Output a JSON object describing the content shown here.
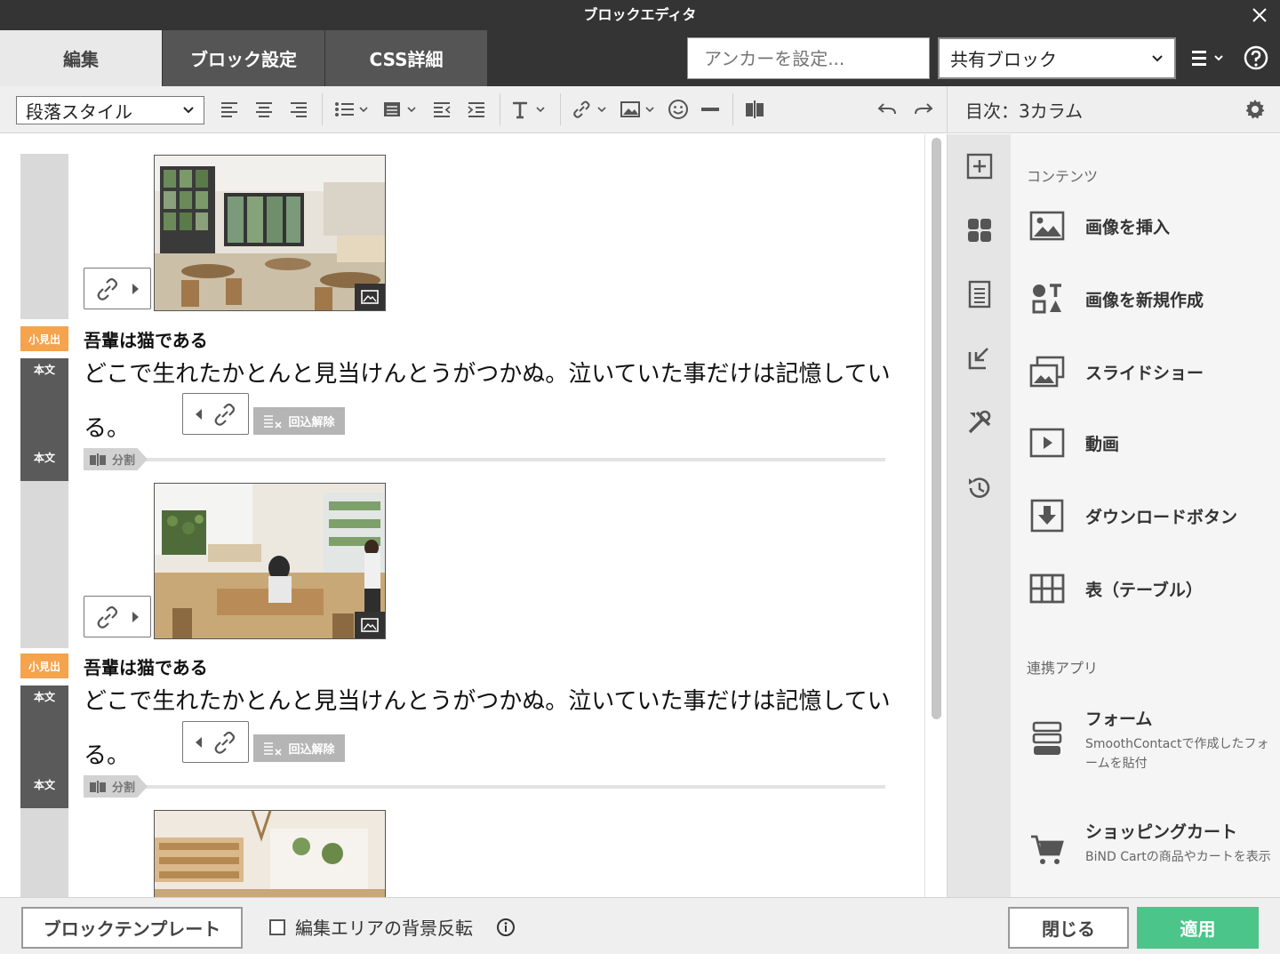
{
  "window": {
    "title": "ブロックエディタ"
  },
  "tabs": [
    {
      "label": "編集",
      "active": true
    },
    {
      "label": "ブロック設定",
      "active": false
    },
    {
      "label": "CSS詳細",
      "active": false
    }
  ],
  "anchor": {
    "placeholder": "アンカーを設定..."
  },
  "shared_block": {
    "value": "共有ブロック"
  },
  "toolbar": {
    "paragraph_style": "段落スタイル"
  },
  "side_header": {
    "title": "目次：3カラム"
  },
  "editor": {
    "blocks": [
      {
        "heading_tag": "小見出",
        "heading": "吾輩は猫である",
        "body_tag": "本文",
        "body_text": "どこで生れたかとんと見当けんとうがつかぬ。泣いていた事だけは記憶している。",
        "body_tag2": "本文",
        "wrap_badge": "回込解除",
        "divider": "分割"
      },
      {
        "heading_tag": "小見出",
        "heading": "吾輩は猫である",
        "body_tag": "本文",
        "body_text": "どこで生れたかとんと見当けんとうがつかぬ。泣いていた事だけは記憶している。",
        "body_tag2": "本文",
        "wrap_badge": "回込解除",
        "divider": "分割"
      }
    ]
  },
  "panel": {
    "section_contents": "コンテンツ",
    "items": [
      {
        "label": "画像を挿入",
        "icon": "image-icon"
      },
      {
        "label": "画像を新規作成",
        "icon": "shapes-icon"
      },
      {
        "label": "スライドショー",
        "icon": "slideshow-icon"
      },
      {
        "label": "動画",
        "icon": "video-icon"
      },
      {
        "label": "ダウンロードボタン",
        "icon": "download-icon"
      },
      {
        "label": "表（テーブル）",
        "icon": "table-icon"
      }
    ],
    "section_apps": "連携アプリ",
    "apps": [
      {
        "label": "フォーム",
        "desc": "SmoothContactで作成したフォームを貼付",
        "icon": "form-icon"
      },
      {
        "label": "ショッピングカート",
        "desc": "BiND Cartの商品やカートを表示",
        "icon": "cart-icon"
      }
    ]
  },
  "footer": {
    "template_btn": "ブロックテンプレート",
    "checkbox_label": "編集エリアの背景反転",
    "close_btn": "閉じる",
    "apply_btn": "適用"
  },
  "colors": {
    "titlebar": "#343434",
    "apply": "#4cc58a",
    "heading_tag": "#f5a34d"
  }
}
